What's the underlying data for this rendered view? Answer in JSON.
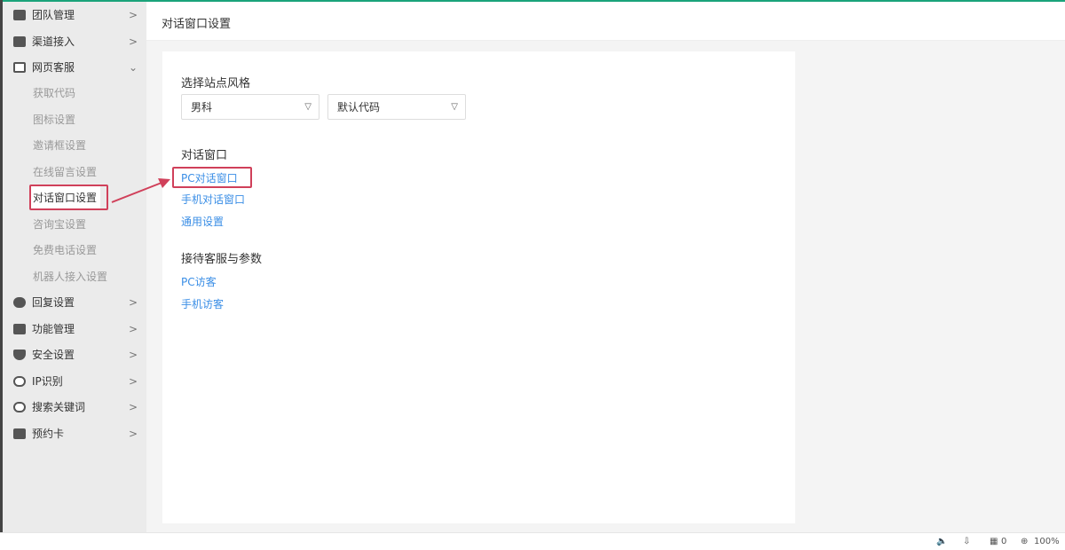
{
  "sidebar": {
    "top_items": [
      {
        "label": "团队管理",
        "icon": "team-icon"
      },
      {
        "label": "渠道接入",
        "icon": "user-icon"
      },
      {
        "label": "网页客服",
        "icon": "browser-icon"
      }
    ],
    "sub_items": [
      "获取代码",
      "图标设置",
      "邀请框设置",
      "在线留言设置",
      "对话窗口设置",
      "咨询宝设置",
      "免费电话设置",
      "机器人接入设置"
    ],
    "bottom_items": [
      {
        "label": "回复设置",
        "icon": "chat-icon"
      },
      {
        "label": "功能管理",
        "icon": "book-icon"
      },
      {
        "label": "安全设置",
        "icon": "shield-icon"
      },
      {
        "label": "IP识别",
        "icon": "ip-search-icon"
      },
      {
        "label": "搜索关键词",
        "icon": "search-icon"
      },
      {
        "label": "预约卡",
        "icon": "card-icon"
      }
    ]
  },
  "header": {
    "title": "对话窗口设置"
  },
  "main": {
    "style_label": "选择站点风格",
    "select1": "男科",
    "select2": "默认代码",
    "dialog_label": "对话窗口",
    "dialog_links": [
      "PC对话窗口",
      "手机对话窗口",
      "通用设置"
    ],
    "reception_label": "接待客服与参数",
    "reception_links": [
      "PC访客",
      "手机访客"
    ]
  },
  "statusbar": {
    "count": "0",
    "zoom": "100%"
  },
  "colors": {
    "accent": "#1aa37a",
    "link": "#3a8ee6",
    "annotation": "#d0405a"
  }
}
